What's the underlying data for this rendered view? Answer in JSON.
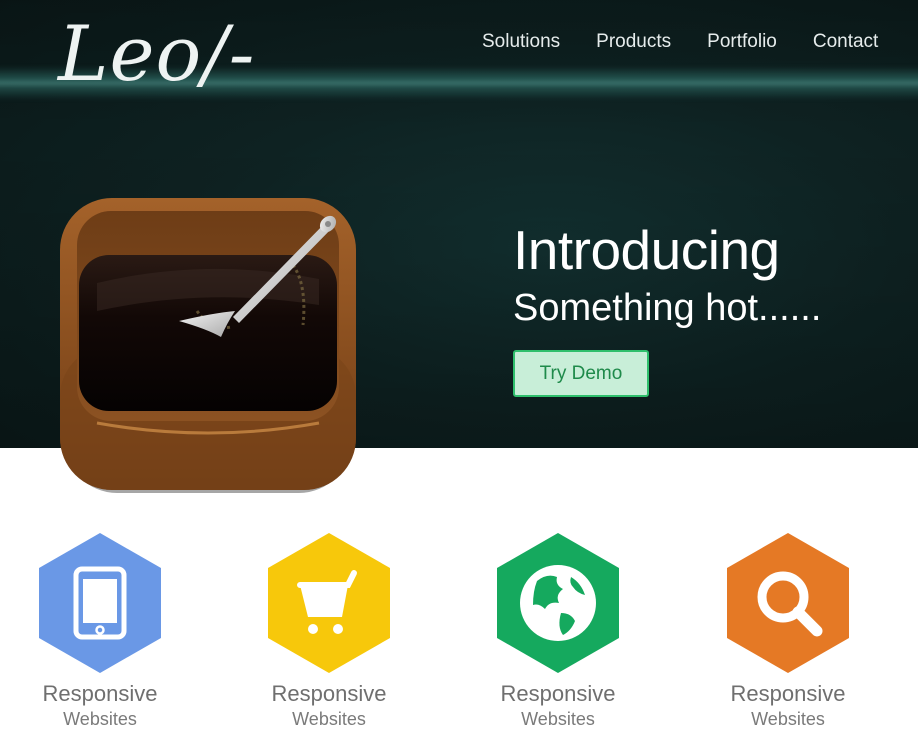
{
  "header": {
    "logo_text": "Leo/-",
    "nav": [
      "Solutions",
      "Products",
      "Portfolio",
      "Contact"
    ]
  },
  "hero": {
    "headline": "Introducing",
    "subline": "Something hot......",
    "cta_label": "Try Demo",
    "icon": "coffee-box-app-icon"
  },
  "features": [
    {
      "icon": "smartphone-icon",
      "color": "#6a98e6",
      "title": "Responsive",
      "subtitle": "Websites"
    },
    {
      "icon": "shopping-cart-icon",
      "color": "#f7c80b",
      "title": "Responsive",
      "subtitle": "Websites"
    },
    {
      "icon": "globe-icon",
      "color": "#15a95e",
      "title": "Responsive",
      "subtitle": "Websites"
    },
    {
      "icon": "search-icon",
      "color": "#e57925",
      "title": "Responsive",
      "subtitle": "Websites"
    }
  ],
  "colors": {
    "hero_bg": "#0e2222",
    "cta_border": "#2fbf6c",
    "cta_bg": "#c8eed8"
  }
}
